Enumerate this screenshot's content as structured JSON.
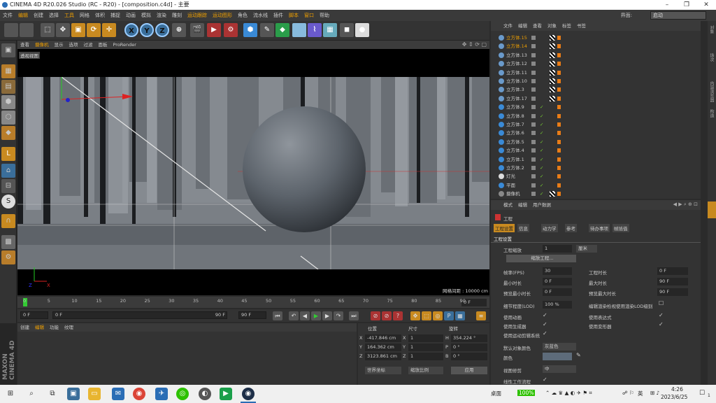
{
  "window": {
    "title": "CINEMA 4D R20.026 Studio (RC - R20) - [composition.c4d] - 主要",
    "minimize": "–",
    "maximize": "❐",
    "close": "✕"
  },
  "menu": {
    "items": [
      "文件",
      "编辑",
      "创建",
      "选择",
      "工具",
      "网格",
      "体积",
      "捕捉",
      "动画",
      "模拟",
      "渲染",
      "雕刻",
      "运动跟踪",
      "运动图形",
      "角色",
      "流水线",
      "插件",
      "脚本",
      "窗口",
      "帮助"
    ],
    "layout_label": "界面:",
    "layout_value": "启动"
  },
  "toolbar": {
    "icons": [
      "undo-icon",
      "redo-icon",
      "select-live-icon",
      "move-icon",
      "scale-icon",
      "rotate-icon",
      "transform-icon",
      "x-axis-icon",
      "y-axis-icon",
      "z-axis-icon",
      "world-coord-icon",
      "render-view-icon",
      "render-picture-icon",
      "render-settings-icon",
      "cube-icon",
      "pen-icon",
      "subdivision-icon",
      "extrude-icon",
      "deformer-icon",
      "floor-icon",
      "camera-icon",
      "light-icon"
    ],
    "axes": [
      "X",
      "Y",
      "Z"
    ]
  },
  "viewport": {
    "menu": [
      "查看",
      "摄像机",
      "显示",
      "选项",
      "过滤",
      "面板",
      "ProRender"
    ],
    "active_menu": "摄像机",
    "label": "透视视图",
    "grid_distance": "网格间距 : 10000 cm"
  },
  "timeline": {
    "ticks": [
      "0",
      "5",
      "10",
      "15",
      "20",
      "25",
      "30",
      "35",
      "40",
      "45",
      "50",
      "55",
      "60",
      "65",
      "70",
      "75",
      "80",
      "85",
      "90"
    ],
    "current": "0 F"
  },
  "playback": {
    "start": "0 F",
    "preview_start": "0 F",
    "preview_end": "90 F",
    "end": "90 F"
  },
  "material": {
    "menu": [
      "创建",
      "编辑",
      "功能",
      "纹理"
    ]
  },
  "coords": {
    "headers": [
      "位置",
      "尺寸",
      "旋转"
    ],
    "rows": [
      {
        "axis": "X",
        "pos": "-417.846 cm",
        "size_axis": "X",
        "size": "1",
        "rot_axis": "H",
        "rot": "354.224 °"
      },
      {
        "axis": "Y",
        "pos": "164.362 cm",
        "size_axis": "Y",
        "size": "1",
        "rot_axis": "P",
        "rot": "0 °"
      },
      {
        "axis": "Z",
        "pos": "3123.861 cm",
        "size_axis": "Z",
        "size": "1",
        "rot_axis": "B",
        "rot": "0 °"
      }
    ],
    "mode1": "世界坐标",
    "mode2": "缩放比例",
    "apply": "应用"
  },
  "objects": {
    "tabs": [
      "文件",
      "编辑",
      "查看",
      "对象",
      "标签",
      "书签"
    ],
    "rows": [
      {
        "name": "立方体.15",
        "color": "#f0a000",
        "type": "null"
      },
      {
        "name": "立方体.14",
        "color": "#f0a000",
        "type": "null"
      },
      {
        "name": "立方体.13",
        "color": "#ccc",
        "type": "null"
      },
      {
        "name": "立方体.12",
        "color": "#ccc",
        "type": "null"
      },
      {
        "name": "立方体.11",
        "color": "#ccc",
        "type": "null"
      },
      {
        "name": "立方体.10",
        "color": "#ccc",
        "type": "null"
      },
      {
        "name": "立方体.3",
        "color": "#ccc",
        "type": "null"
      },
      {
        "name": "立方体.17",
        "color": "#ccc",
        "type": "null"
      },
      {
        "name": "立方体.9",
        "color": "#ccc",
        "type": "cube"
      },
      {
        "name": "立方体.8",
        "color": "#ccc",
        "type": "cube"
      },
      {
        "name": "立方体.7",
        "color": "#ccc",
        "type": "cube"
      },
      {
        "name": "立方体.6",
        "color": "#ccc",
        "type": "cube"
      },
      {
        "name": "立方体.5",
        "color": "#ccc",
        "type": "cube"
      },
      {
        "name": "立方体.4",
        "color": "#ccc",
        "type": "cube"
      },
      {
        "name": "立方体.1",
        "color": "#ccc",
        "type": "cube"
      },
      {
        "name": "立方体.2",
        "color": "#ccc",
        "type": "cube"
      },
      {
        "name": "灯光",
        "color": "#ccc",
        "type": "light"
      },
      {
        "name": "平面",
        "color": "#ccc",
        "type": "cube"
      },
      {
        "name": "摄像机",
        "color": "#ccc",
        "type": "camera"
      }
    ]
  },
  "side_tabs": [
    "对象",
    "场次",
    "内容浏览器",
    "构造"
  ],
  "attributes": {
    "menu": [
      "模式",
      "编辑",
      "用户数据"
    ],
    "object": "工程",
    "tabs": [
      "工程设置",
      "信息",
      "动力学",
      "参考",
      "待办事项",
      "帧插值"
    ],
    "active_tab": "工程设置",
    "section": "工程设置",
    "scale_label": "工程缩放",
    "scale_value": "1",
    "scale_unit": "厘米",
    "scale_button": "缩放工程...",
    "left": [
      {
        "label": "帧率(FPS)",
        "value": "30"
      },
      {
        "label": "最小时长",
        "value": "0 F"
      },
      {
        "label": "预览最小时长",
        "value": "0 F"
      }
    ],
    "right": [
      {
        "label": "工程时长",
        "value": "0 F"
      },
      {
        "label": "最大时长",
        "value": "90 F"
      },
      {
        "label": "预览最大时长",
        "value": "90 F"
      }
    ],
    "lod_label": "细节程度(LOD)",
    "lod_value": "100 %",
    "lod_check": "编辑渲染检视使用渲染LOD级别",
    "checks_left": [
      "使用动画",
      "使用生成器",
      "使用运动剪辑系统"
    ],
    "checks_right": [
      "使用表达式",
      "使用变形器"
    ],
    "default_color_label": "默认对象颜色",
    "default_color_value": "灰蓝色",
    "color_label": "颜色",
    "view_clip_label": "视图修剪",
    "view_clip_value": "中",
    "linear_label": "线性工作流程"
  },
  "taskbar": {
    "desktop": "桌面",
    "battery": "100%",
    "ime": "英",
    "time": "4:26",
    "date": "2023/6/25",
    "notify": "1"
  }
}
